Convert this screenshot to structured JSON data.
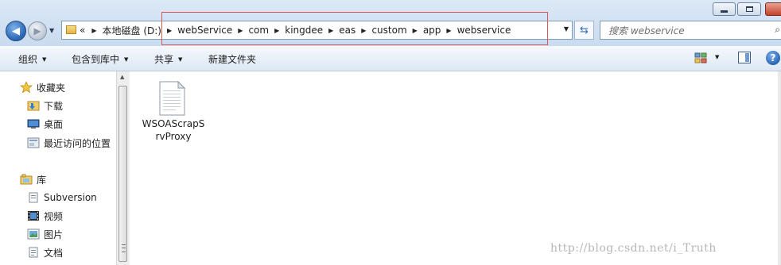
{
  "window": {
    "minimize_icon": "minimize-icon",
    "maximize_icon": "maximize-icon",
    "close_icon": "close-icon"
  },
  "navigation": {
    "back_icon": "arrow-left-icon",
    "forward_icon": "arrow-right-icon"
  },
  "address_bar": {
    "overflow": "«",
    "crumbs": [
      "本地磁盘 (D:)",
      "webService",
      "com",
      "kingdee",
      "eas",
      "custom",
      "app",
      "webservice"
    ]
  },
  "search": {
    "placeholder": "搜索 webservice"
  },
  "toolbar": {
    "organize": "组织",
    "include_in_library": "包含到库中",
    "share": "共享",
    "new_folder": "新建文件夹"
  },
  "sidebar": {
    "favorites_title": "收藏夹",
    "favorites": [
      "下载",
      "桌面",
      "最近访问的位置"
    ],
    "libraries_title": "库",
    "libraries": [
      "Subversion",
      "视频",
      "图片",
      "文档"
    ]
  },
  "files": [
    {
      "name": "WSOAScrapSrvProxy",
      "icon": "document-icon"
    }
  ],
  "watermark": "http://blog.csdn.net/i_Truth",
  "colors": {
    "highlight_box": "#e05555",
    "titlebar": "#c9dbef"
  }
}
